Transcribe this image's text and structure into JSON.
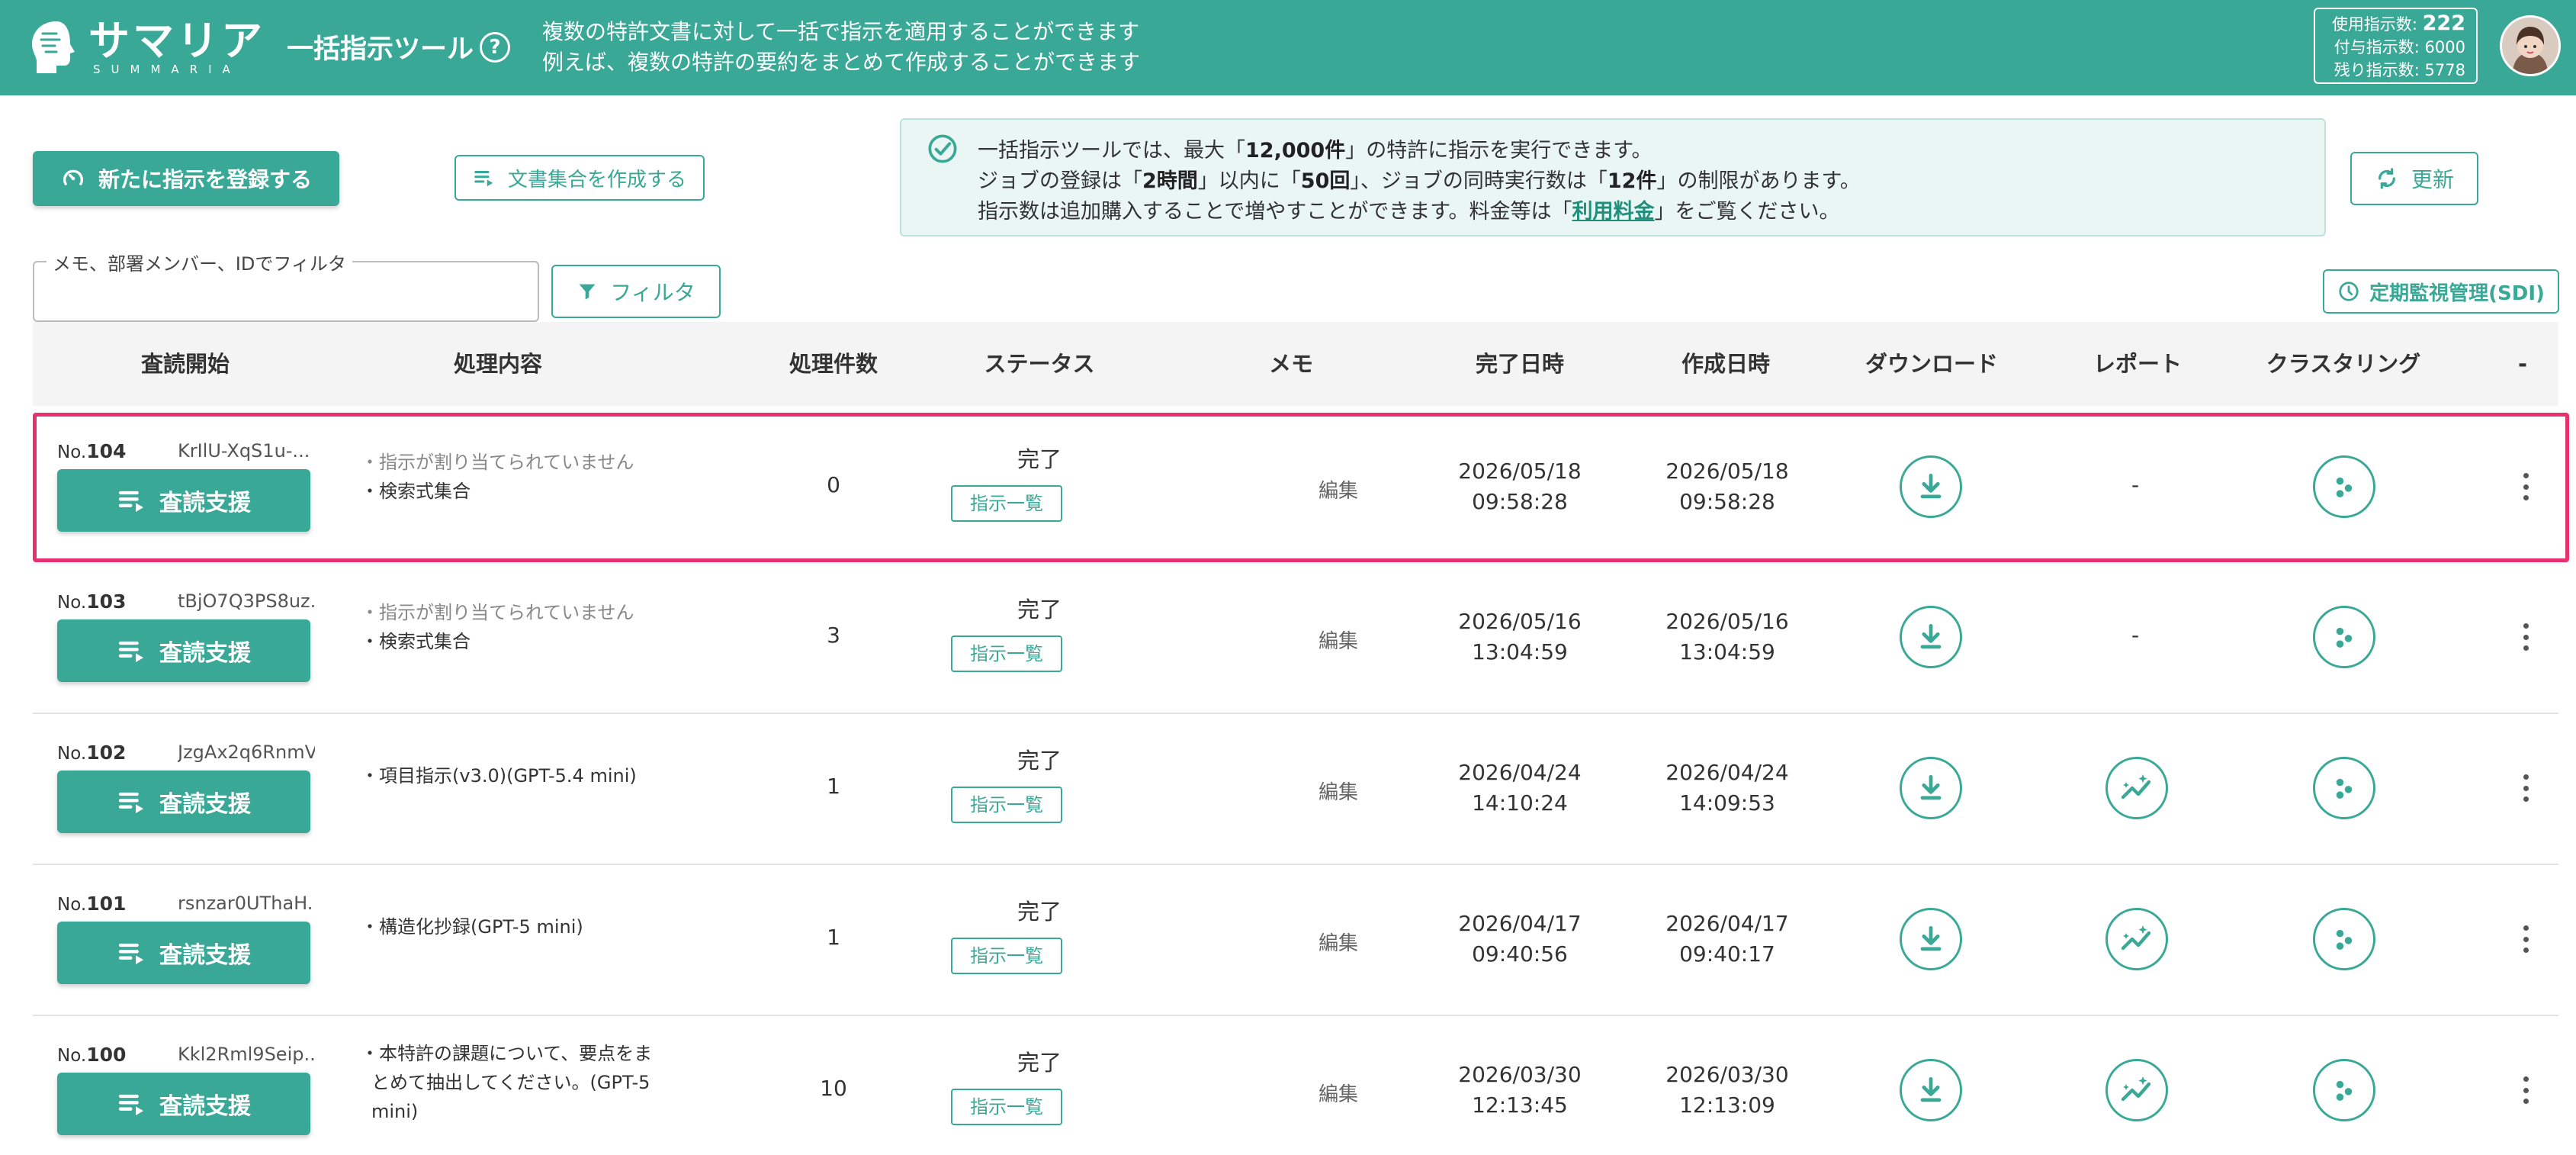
{
  "header": {
    "logo_jp": "サマリア",
    "logo_en": "SUMMARIA",
    "app_title": "一括指示ツール",
    "help": "?",
    "desc1": "複数の特許文書に対して一括で指示を適用することができます",
    "desc2": "例えば、複数の特許の要約をまとめて作成することができます",
    "usage_label": "使用指示数:",
    "usage_value": "222",
    "granted": "付与指示数: 6000",
    "remaining": "残り指示数: 5778"
  },
  "toolbar": {
    "register_label": "新たに指示を登録する",
    "create_set_label": "文書集合を作成する",
    "refresh_label": "更新",
    "filter_label": "フィルタ",
    "filter_field_label": "メモ、部署メンバー、IDでフィルタ",
    "filter_value": "",
    "sdi_label": "定期監視管理(SDI)"
  },
  "info": {
    "line1_a": "一括指示ツールでは、最大「",
    "line1_b": "12,000件",
    "line1_c": "」の特許に指示を実行できます。",
    "line2_a": "ジョブの登録は「",
    "line2_b": "2時間",
    "line2_c": "」以内に「",
    "line2_d": "50回",
    "line2_e": "」、ジョブの同時実行数は「",
    "line2_f": "12件",
    "line2_g": "」の制限があります。",
    "line3_a": "指示数は追加購入することで増やすことができます。料金等は「",
    "line3_link": "利用料金",
    "line3_c": "」をご覧ください。"
  },
  "table": {
    "headers": [
      "査読開始",
      "処理内容",
      "処理件数",
      "ステータス",
      "メモ",
      "完了日時",
      "作成日時",
      "ダウンロード",
      "レポート",
      "クラスタリング",
      "-"
    ],
    "rows": [
      {
        "no_prefix": "No.",
        "no": "104",
        "id": "KrIlU-XqS1u-...",
        "btn": "査読支援",
        "proc1": "・指示が割り当てられていません",
        "proc2": "・検索式集合",
        "count": "0",
        "status": "完了",
        "list": "指示一覧",
        "memo": "編集",
        "done_date": "2026/05/18",
        "done_time": "09:58:28",
        "created_date": "2026/05/18",
        "created_time": "09:58:28",
        "report": "-"
      },
      {
        "no_prefix": "No.",
        "no": "103",
        "id": "tBjO7Q3PS8uz...",
        "btn": "査読支援",
        "proc1": "・指示が割り当てられていません",
        "proc2": "・検索式集合",
        "count": "3",
        "status": "完了",
        "list": "指示一覧",
        "memo": "編集",
        "done_date": "2026/05/16",
        "done_time": "13:04:59",
        "created_date": "2026/05/16",
        "created_time": "13:04:59",
        "report": "-"
      },
      {
        "no_prefix": "No.",
        "no": "102",
        "id": "JzgAx2q6RnmV...",
        "btn": "査読支援",
        "proc1": "・項目指示(v3.0)(GPT-5.4 mini)",
        "count": "1",
        "status": "完了",
        "list": "指示一覧",
        "memo": "編集",
        "done_date": "2026/04/24",
        "done_time": "14:10:24",
        "created_date": "2026/04/24",
        "created_time": "14:09:53"
      },
      {
        "no_prefix": "No.",
        "no": "101",
        "id": "rsnzar0UThaH...",
        "btn": "査読支援",
        "proc1": "・構造化抄録(GPT-5 mini)",
        "count": "1",
        "status": "完了",
        "list": "指示一覧",
        "memo": "編集",
        "done_date": "2026/04/17",
        "done_time": "09:40:56",
        "created_date": "2026/04/17",
        "created_time": "09:40:17"
      },
      {
        "no_prefix": "No.",
        "no": "100",
        "id": "Kkl2Rml9Seip...",
        "btn": "査読支援",
        "proc1": "・本特許の課題について、要点をま",
        "proc2": "とめて抽出してください。(GPT-5",
        "proc3": "mini)",
        "count": "10",
        "status": "完了",
        "list": "指示一覧",
        "memo": "編集",
        "done_date": "2026/03/30",
        "done_time": "12:13:45",
        "created_date": "2026/03/30",
        "created_time": "12:13:09"
      }
    ]
  }
}
